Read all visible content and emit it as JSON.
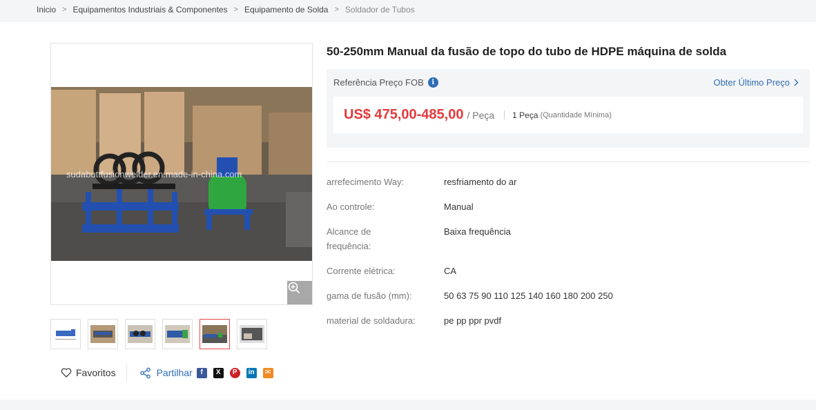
{
  "breadcrumb": {
    "items": [
      "Inicio",
      "Equipamentos Industriais & Componentes",
      "Equipamento de Solda"
    ],
    "current": "Soldador de Tubos"
  },
  "gallery": {
    "watermark": "sudabuttfusionwelder.en.made-in-china.com",
    "zoom_icon": "zoom-in-icon",
    "thumbnail_count": 6,
    "active_thumbnail": 5
  },
  "actions": {
    "favorites_label": "Favoritos",
    "share_label": "Partilhar",
    "social": [
      "facebook",
      "x",
      "pinterest",
      "linkedin",
      "email"
    ]
  },
  "product": {
    "title": "50-250mm Manual da fusão de topo do tubo de HDPE máquina de solda"
  },
  "price": {
    "reference_label": "Referência Preço FOB",
    "latest_link": "Obter Último Preço",
    "value": "US$ 475,00-485,00",
    "unit": "/ Peça",
    "moq": "1 Peça",
    "moq_note": "(Quantidade Mínima)"
  },
  "attributes": [
    {
      "key": "arrefecimento Way:",
      "value": "resfriamento do ar"
    },
    {
      "key": "Ao controle:",
      "value": "Manual"
    },
    {
      "key": "Alcance de frequência:",
      "value": "Baixa frequência"
    },
    {
      "key": "Corrente elétrica:",
      "value": "CA"
    },
    {
      "key": "gama de fusão (mm):",
      "value": "50 63 75 90 110 125 140 160 180 200 250"
    },
    {
      "key": "material de soldadura:",
      "value": "pe pp ppr pvdf"
    }
  ],
  "colors": {
    "price": "#e4393c",
    "link": "#2f6db5",
    "active_thumb": "#e64545"
  }
}
